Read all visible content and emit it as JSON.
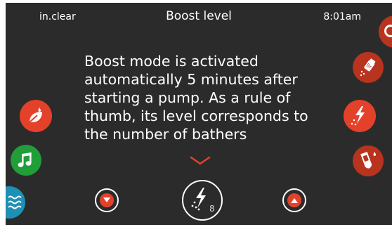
{
  "status_bar": {
    "app_name": "in.clear",
    "title": "Boost level",
    "time": "8:01am"
  },
  "message": {
    "text": "Boost mode is activated automatically 5 minutes after starting a pump. As a rule of thumb, its level corresponds to the number of bathers"
  },
  "boost": {
    "level": "8"
  },
  "colors": {
    "screen_bg": "#2b2b2b",
    "accent_red": "#e4412a",
    "dim_red": "#b8341f",
    "music_green": "#1f9e3a",
    "water_blue": "#1e8fb5"
  },
  "icons": {
    "left": [
      "leaf-drop-icon",
      "music-note-icon",
      "water-waves-icon"
    ],
    "right": [
      "partial-icon",
      "bromine-shaker-icon",
      "boost-lightning-icon",
      "test-tube-icon"
    ],
    "bottom": [
      "decrease-arrow-icon",
      "boost-lightning-icon",
      "increase-arrow-icon"
    ]
  }
}
